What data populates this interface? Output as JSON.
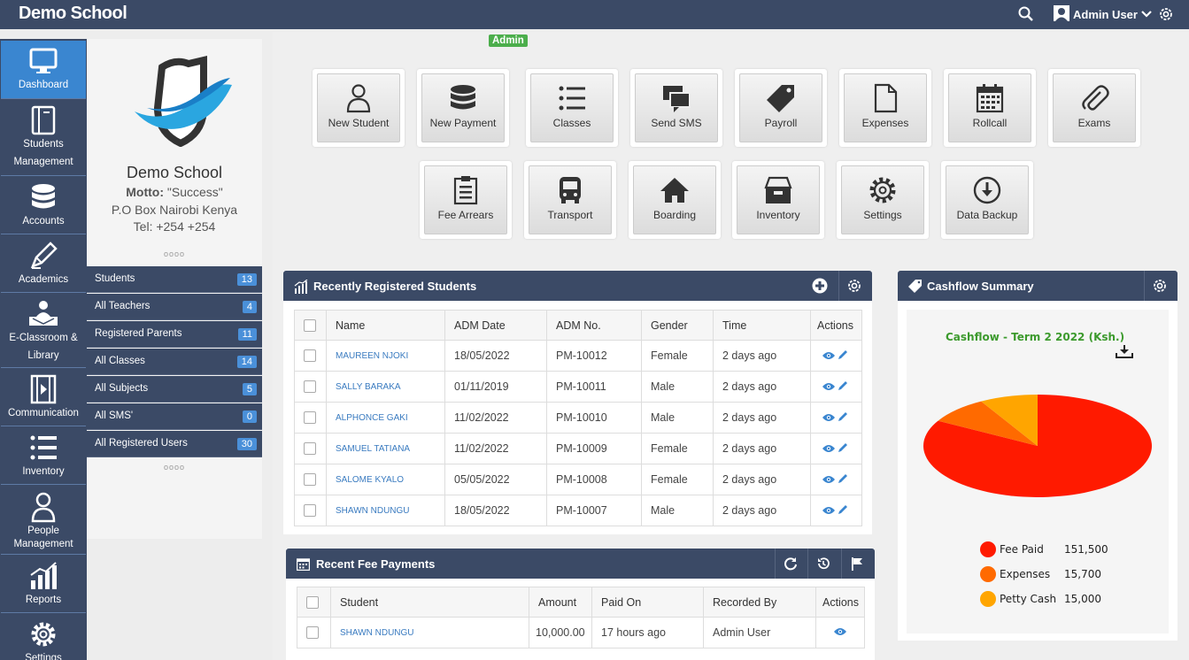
{
  "app": {
    "title": "Demo School",
    "user_name": "Admin User",
    "role_badge": "Admin"
  },
  "nav": [
    {
      "label": "Dashboard",
      "icon": "monitor-icon",
      "active": true
    },
    {
      "label": "Students Management",
      "icon": "book-icon"
    },
    {
      "label": "Accounts",
      "icon": "database-icon"
    },
    {
      "label": "Academics",
      "icon": "pen-icon"
    },
    {
      "label": "E-Classroom & Library",
      "icon": "classroom-icon"
    },
    {
      "label": "Communication",
      "icon": "film-icon"
    },
    {
      "label": "Inventory",
      "icon": "list-icon"
    },
    {
      "label": "People Management",
      "icon": "person-icon"
    },
    {
      "label": "Reports",
      "icon": "bar-chart-icon"
    },
    {
      "label": "Settings",
      "icon": "gear-icon"
    }
  ],
  "profile": {
    "name": "Demo School",
    "motto_label": "Motto:",
    "motto_value": "\"Success\"",
    "address": "P.O Box Nairobi Kenya",
    "phone": "Tel: +254 +254",
    "dots": "oooo"
  },
  "stats": [
    {
      "label": "Students",
      "count": "13"
    },
    {
      "label": "All Teachers",
      "count": "4"
    },
    {
      "label": "Registered Parents",
      "count": "11"
    },
    {
      "label": "All Classes",
      "count": "14"
    },
    {
      "label": "All Subjects",
      "count": "5"
    },
    {
      "label": "All SMS'",
      "count": "0"
    },
    {
      "label": "All Registered Users",
      "count": "30"
    }
  ],
  "tiles": [
    {
      "label": "New Student",
      "icon": "person-icon"
    },
    {
      "label": "New Payment",
      "icon": "database-icon"
    },
    {
      "label": "Classes",
      "icon": "list-icon"
    },
    {
      "label": "Send SMS",
      "icon": "chat-icon"
    },
    {
      "label": "Payroll",
      "icon": "tag-icon"
    },
    {
      "label": "Expenses",
      "icon": "file-icon"
    },
    {
      "label": "Rollcall",
      "icon": "calendar-icon"
    },
    {
      "label": "Exams",
      "icon": "paperclip-icon"
    },
    {
      "label": "Fee Arrears",
      "icon": "clipboard-icon"
    },
    {
      "label": "Transport",
      "icon": "bus-icon"
    },
    {
      "label": "Boarding",
      "icon": "home-icon"
    },
    {
      "label": "Inventory",
      "icon": "archive-icon"
    },
    {
      "label": "Settings",
      "icon": "gear-icon"
    },
    {
      "label": "Data Backup",
      "icon": "download-circle-icon"
    }
  ],
  "students_panel": {
    "title": "Recently Registered Students",
    "columns": [
      "Name",
      "ADM Date",
      "ADM No.",
      "Gender",
      "Time",
      "Actions"
    ],
    "rows": [
      [
        "MAUREEN NJOKI",
        "18/05/2022",
        "PM-10012",
        "Female",
        "2 days ago"
      ],
      [
        "SALLY BARAKA",
        "01/11/2019",
        "PM-10011",
        "Male",
        "2 days ago"
      ],
      [
        "ALPHONCE GAKI",
        "11/02/2022",
        "PM-10010",
        "Male",
        "2 days ago"
      ],
      [
        "SAMUEL TATIANA",
        "11/02/2022",
        "PM-10009",
        "Female",
        "2 days ago"
      ],
      [
        "SALOME KYALO",
        "05/05/2022",
        "PM-10008",
        "Female",
        "2 days ago"
      ],
      [
        "SHAWN NDUNGU",
        "18/05/2022",
        "PM-10007",
        "Male",
        "2 days ago"
      ]
    ]
  },
  "fees_panel": {
    "title": "Recent Fee Payments",
    "columns": [
      "Student",
      "Amount",
      "Paid On",
      "Recorded By",
      "Actions"
    ],
    "rows": [
      [
        "SHAWN NDUNGU",
        "10,000.00",
        "17 hours ago",
        "Admin User"
      ]
    ]
  },
  "cashflow_panel": {
    "title": "Cashflow Summary"
  },
  "chart_data": {
    "type": "pie",
    "title": "Cashflow - Term 2 2022 (Ksh.)",
    "categories": [
      "Fee Paid",
      "Expenses",
      "Petty Cash"
    ],
    "values": [
      151500,
      15700,
      15000
    ],
    "value_labels": [
      "151,500",
      "15,700",
      "15,000"
    ],
    "colors": [
      "#ff1a00",
      "#ff6a00",
      "#ffa500"
    ],
    "legend_placement": "bottom"
  }
}
